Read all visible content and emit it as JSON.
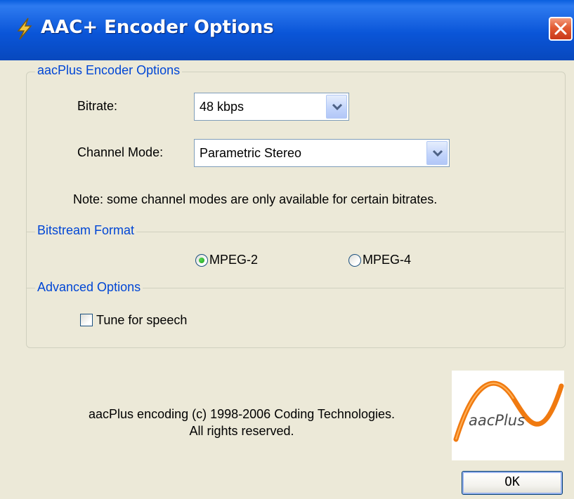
{
  "window": {
    "title": "AAC+ Encoder Options",
    "title_icon": "lightning-bolt-icon",
    "close_icon": "close-icon"
  },
  "encoder_group": {
    "label": "aacPlus Encoder Options",
    "bitrate_label": "Bitrate:",
    "bitrate_value": "48 kbps",
    "channel_label": "Channel Mode:",
    "channel_value": "Parametric Stereo",
    "note": "Note: some channel modes are only available for certain bitrates."
  },
  "bitstream_group": {
    "label": "Bitstream Format",
    "options": [
      {
        "label": "MPEG-2",
        "selected": true
      },
      {
        "label": "MPEG-4",
        "selected": false
      }
    ]
  },
  "advanced_group": {
    "label": "Advanced Options",
    "tune_label": "Tune for speech",
    "tune_checked": false
  },
  "footer": {
    "copyright_line1": "aacPlus encoding (c) 1998-2006 Coding Technologies.",
    "copyright_line2": "All rights reserved.",
    "logo_text": "aacPlus",
    "ok_label": "OK"
  },
  "colors": {
    "title_bar": "#0a55d8",
    "group_label": "#0046d5",
    "dialog_bg": "#ece9d8",
    "logo_orange": "#f07a10"
  }
}
